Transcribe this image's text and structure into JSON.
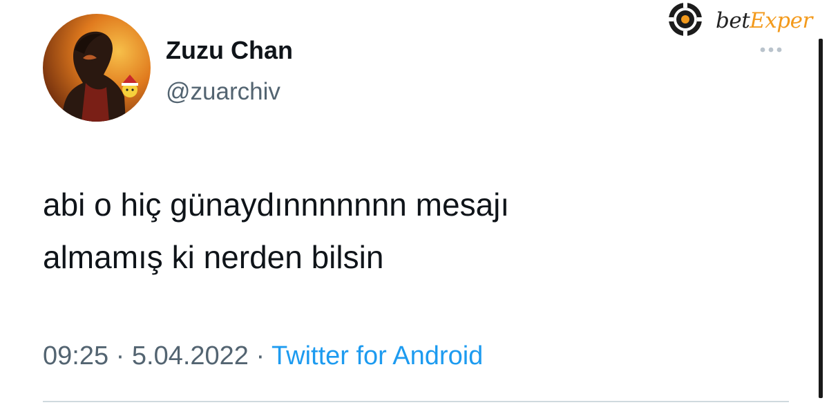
{
  "tweet": {
    "author": {
      "display_name": "Zuzu Chan",
      "handle": "@zuarchiv"
    },
    "text_line_1": "abi o hiç günaydınnnnnnn mesajı",
    "text_line_2": "almamış ki nerden bilsin",
    "time": "09:25",
    "separator": " · ",
    "date": "5.04.2022",
    "source": "Twitter for Android",
    "more_icon": "more-dots-icon"
  },
  "watermark": {
    "brand_prefix": "bet",
    "brand_accent": "Exper",
    "icon": "poker-chip-icon"
  },
  "colors": {
    "text_primary": "#0f1419",
    "text_secondary": "#536471",
    "link": "#1d9bf0",
    "brand_accent": "#f39a1c",
    "divider": "#cfd9de"
  }
}
